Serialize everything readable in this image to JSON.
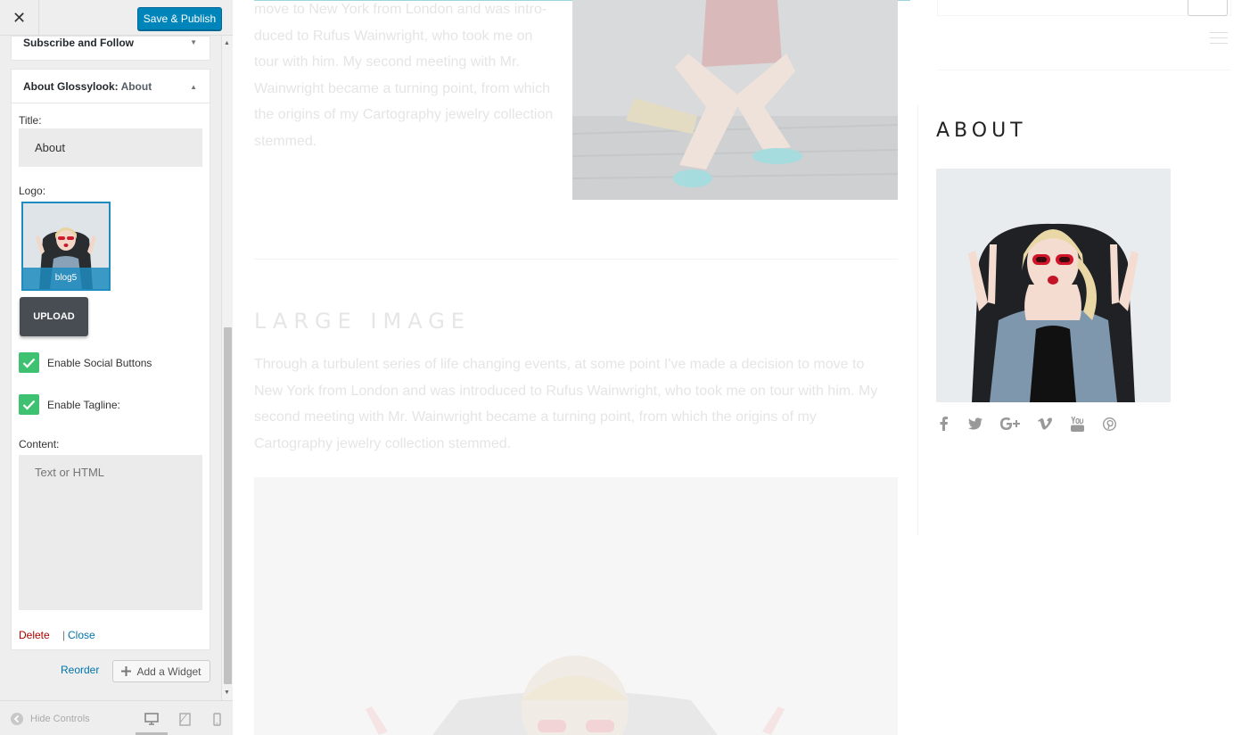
{
  "header": {
    "close_glyph": "✕",
    "save_label": "Save & Publish"
  },
  "widgets": {
    "subscribe_title": "Subscribe and Follow",
    "about_title": "About Glossylook:",
    "about_subtitle": "About"
  },
  "form": {
    "title_label": "Title:",
    "title_value": "About",
    "logo_label": "Logo:",
    "logo_filename": "blog5",
    "upload_label": "UPLOAD",
    "social_label": "Enable Social Buttons",
    "social_checked": true,
    "tagline_label": "Enable Tagline:",
    "tagline_checked": true,
    "content_label": "Content:",
    "content_placeholder": "Text or HTML",
    "delete_label": "Delete",
    "separator": "|",
    "close_label": "Close"
  },
  "footer_actions": {
    "reorder_label": "Reorder",
    "add_widget_label": "Add a Widget"
  },
  "bottom_bar": {
    "hide_controls_label": "Hide Controls",
    "devices": [
      "desktop",
      "tablet",
      "mobile"
    ],
    "active_device": "desktop"
  },
  "preview": {
    "intro_text": "move to New York from London and was intro-duced to Rufus Wainwright, who took me on tour with him. My second meeting with Mr. Wainwright became a turning point, from which the origins of my Cartography jewelry collection stemmed.",
    "section_heading": "LARGE IMAGE",
    "section_text": "Through a turbulent series of life changing events, at some point I've made a decision to move to New York from London and was introduced to Rufus Wainwright, who took me on tour with him. My second meeting with Mr. Wainwright became a turning point, from which the origins of my Cartography jewelry collection stemmed.",
    "about_title": "ABOUT",
    "social_icons": [
      "facebook-icon",
      "twitter-icon",
      "google-plus-icon",
      "vimeo-icon",
      "youtube-icon",
      "pinterest-icon"
    ]
  },
  "colors": {
    "primary_button": "#0085ba",
    "checkbox_green": "#3ec272",
    "delete_red": "#aa0000",
    "link_blue": "#0073aa",
    "upload_button": "#484d54"
  }
}
